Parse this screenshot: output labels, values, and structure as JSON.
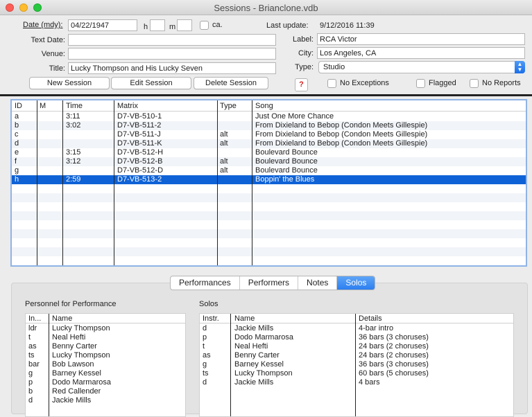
{
  "window": {
    "title": "Sessions - Brianclone.vdb"
  },
  "form": {
    "date_label": "Date (mdy):",
    "date_value": "04/22/1947",
    "h_label": "h",
    "m_label": "m",
    "h_value": "",
    "m_value": "",
    "ca_label": "ca.",
    "last_update_label": "Last update:",
    "last_update_value": "9/12/2016 11:39",
    "text_date_label": "Text Date:",
    "text_date_value": "",
    "venue_label": "Venue:",
    "venue_value": "",
    "title_label": "Title:",
    "title_value": "Lucky Thompson and His Lucky Seven",
    "label_label": "Label:",
    "label_value": "RCA Victor",
    "city_label": "City:",
    "city_value": "Los Angeles, CA",
    "type_label": "Type:",
    "type_value": "Studio",
    "new_session": "New Session",
    "edit_session": "Edit Session",
    "delete_session": "Delete Session",
    "help": "?",
    "no_exceptions": "No Exceptions",
    "flagged": "Flagged",
    "no_reports": "No Reports"
  },
  "sessions": {
    "headers": [
      "ID",
      "M",
      "Time",
      "Matrix",
      "Type",
      "Song"
    ],
    "rows": [
      {
        "id": "a",
        "m": "",
        "time": "3:11",
        "matrix": "D7-VB-510-1",
        "type": "",
        "song": "Just One More Chance"
      },
      {
        "id": "b",
        "m": "",
        "time": "3:02",
        "matrix": "D7-VB-511-2",
        "type": "",
        "song": "From Dixieland to Bebop (Condon Meets Gillespie)"
      },
      {
        "id": "c",
        "m": "",
        "time": "",
        "matrix": "D7-VB-511-J",
        "type": "alt",
        "song": "From Dixieland to Bebop (Condon Meets Gillespie)"
      },
      {
        "id": "d",
        "m": "",
        "time": "",
        "matrix": "D7-VB-511-K",
        "type": "alt",
        "song": "From Dixieland to Bebop (Condon Meets Gillespie)"
      },
      {
        "id": "e",
        "m": "",
        "time": "3:15",
        "matrix": "D7-VB-512-H",
        "type": "",
        "song": "Boulevard Bounce"
      },
      {
        "id": "f",
        "m": "",
        "time": "3:12",
        "matrix": "D7-VB-512-B",
        "type": "alt",
        "song": "Boulevard Bounce"
      },
      {
        "id": "g",
        "m": "",
        "time": "",
        "matrix": "D7-VB-512-D",
        "type": "alt",
        "song": "Boulevard Bounce"
      },
      {
        "id": "h",
        "m": "",
        "time": "2:59",
        "matrix": "D7-VB-513-2",
        "type": "",
        "song": "Boppin' the Blues"
      }
    ],
    "selected_index": 7
  },
  "tabs": [
    "Performances",
    "Performers",
    "Notes",
    "Solos"
  ],
  "active_tab": "Solos",
  "personnel": {
    "title": "Personnel for Performance",
    "headers": [
      "In...",
      "Name"
    ],
    "rows": [
      [
        "ldr",
        "Lucky Thompson"
      ],
      [
        "t",
        "Neal Hefti"
      ],
      [
        "as",
        "Benny Carter"
      ],
      [
        "ts",
        "Lucky Thompson"
      ],
      [
        "bar",
        "Bob Lawson"
      ],
      [
        "g",
        "Barney Kessel"
      ],
      [
        "p",
        "Dodo Marmarosa"
      ],
      [
        "b",
        "Red Callender"
      ],
      [
        "d",
        "Jackie Mills"
      ]
    ]
  },
  "solos": {
    "title": "Solos",
    "headers": [
      "Instr.",
      "Name",
      "Details"
    ],
    "rows": [
      [
        "d",
        "Jackie Mills",
        "4-bar intro"
      ],
      [
        "p",
        "Dodo Marmarosa",
        "36 bars (3 choruses)"
      ],
      [
        "t",
        "Neal Hefti",
        "24 bars (2 choruses)"
      ],
      [
        "as",
        "Benny Carter",
        "24 bars (2 choruses)"
      ],
      [
        "g",
        "Barney Kessel",
        "36 bars (3 choruses)"
      ],
      [
        "ts",
        "Lucky Thompson",
        "60 bars (5 choruses)"
      ],
      [
        "d",
        "Jackie Mills",
        "4 bars"
      ]
    ]
  }
}
